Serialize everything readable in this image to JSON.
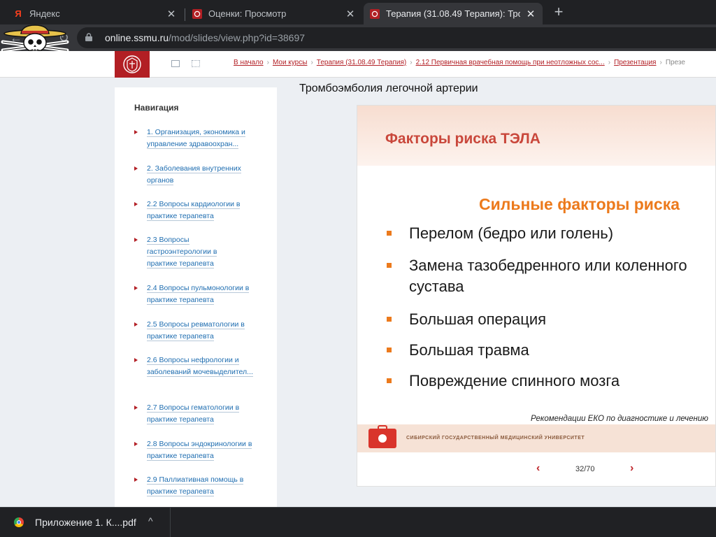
{
  "tabs": [
    {
      "title": "Яндекс",
      "favicon": "Я"
    },
    {
      "title": "Оценки: Просмотр",
      "favicon": "crest"
    },
    {
      "title": "Терапия (31.08.49 Терапия): Тро",
      "favicon": "crest"
    }
  ],
  "address": {
    "host": "online.ssmu.ru",
    "path": "/mod/slides/view.php?id=38697"
  },
  "breadcrumbs": [
    "В начало",
    "Мои курсы",
    "Терапия (31.08.49 Терапия)",
    "2.12 Первичная врачебная помощь при неотложных сос...",
    "Презентация",
    "Презе"
  ],
  "navigation": {
    "title": "Навигация",
    "items": [
      {
        "label": "1. Организация, экономика и управление здравоохран..."
      },
      {
        "label": "2. Заболевания внутренних органов"
      },
      {
        "label": "2.2 Вопросы кардиологии в практике терапевта"
      },
      {
        "label": "2.3 Вопросы гастроэнтерологии в практике терапевта"
      },
      {
        "label": "2.4 Вопросы пульмонологии в практике терапевта"
      },
      {
        "label": "2.5 Вопросы ревматологии в практике терапевта"
      },
      {
        "label": "2.6 Вопросы нефрологии и заболеваний мочевыделител..."
      },
      {
        "label": "2.7 Вопросы гематологии в практике терапевта"
      },
      {
        "label": "2.8 Вопросы эндокринологии в практике терапевта"
      },
      {
        "label": "2.9 Паллиативная помощь в практике терапевта"
      }
    ]
  },
  "page_title": "Тромбоэмболия легочной артерии",
  "slide": {
    "heading": "Факторы риска ТЭЛА",
    "subheading": "Сильные факторы риска",
    "bullets": [
      {
        "line1": "Перелом (бедро или голень)",
        "line2": ""
      },
      {
        "line1": "Замена тазобедренного или коленного",
        "line2": "сустава"
      },
      {
        "line1": "Большая операция",
        "line2": ""
      },
      {
        "line1": "Большая травма",
        "line2": ""
      },
      {
        "line1": "Повреждение спинного мозга",
        "line2": ""
      }
    ],
    "reference": "Рекомендации ЕКО по диагностике и лечению",
    "footer_org": "СИБИРСКИЙ ГОСУДАРСТВЕННЫЙ МЕДИЦИНСКИЙ УНИВЕРСИТЕТ"
  },
  "pager": {
    "label": "32/70",
    "prev": "‹",
    "next": "›"
  },
  "download": {
    "filename": "Приложение 1. К....pdf"
  },
  "icons": {
    "back": "back-arrow-icon",
    "reload": "reload-icon",
    "lock": "lock-icon",
    "close": "close-icon",
    "new_tab": "plus-icon",
    "mail": "mail-icon",
    "grid": "grid-icon",
    "chevron_up": "chevron-up-icon"
  },
  "colors": {
    "brand_red": "#b21f24",
    "link_blue": "#1e6db0",
    "slide_orange": "#ec7a1c",
    "slide_heading": "#c9473b"
  }
}
